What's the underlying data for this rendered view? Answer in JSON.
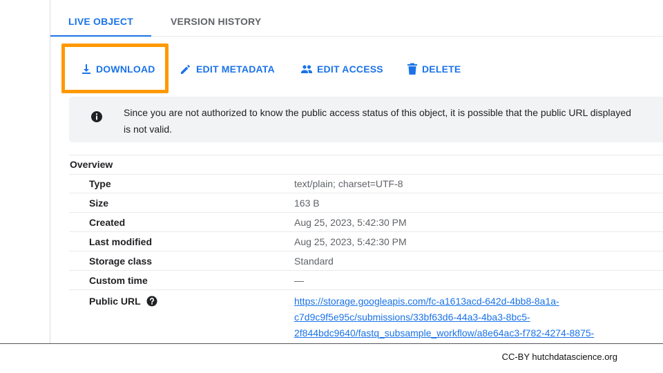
{
  "tabs": [
    {
      "label": "LIVE OBJECT",
      "active": true
    },
    {
      "label": "VERSION HISTORY",
      "active": false
    }
  ],
  "toolbar": {
    "download_label": "DOWNLOAD",
    "edit_metadata_label": "EDIT METADATA",
    "edit_access_label": "EDIT ACCESS",
    "delete_label": "DELETE",
    "highlight_color": "#ff9900",
    "accent_color": "#1a73e8"
  },
  "alert": {
    "icon": "info-icon",
    "line1": "Since you are not authorized to know the public access status of this object, it is possible that the public URL displayed",
    "line2": "is not valid."
  },
  "overview": {
    "title": "Overview",
    "rows": [
      {
        "key": "Type",
        "value": "text/plain; charset=UTF-8"
      },
      {
        "key": "Size",
        "value": "163 B"
      },
      {
        "key": "Created",
        "value": "Aug 25, 2023, 5:42:30 PM"
      },
      {
        "key": "Last modified",
        "value": "Aug 25, 2023, 5:42:30 PM"
      },
      {
        "key": "Storage class",
        "value": "Standard"
      },
      {
        "key": "Custom time",
        "value": "—"
      }
    ],
    "public_url": {
      "key": "Public URL",
      "help_icon": "help-circle-icon",
      "lines": [
        "https://storage.googleapis.com/fc-a1613acd-642d-4bb8-8a1a-",
        "c7d9c9f5e95c/submissions/33bf63d6-44a3-4ba3-8bc5-",
        "2f844bdc9640/fastq_subsample_workflow/a8e64ac3-f782-4274-8875-"
      ]
    }
  },
  "footer": {
    "credit": "CC-BY  hutchdatascience.org"
  }
}
